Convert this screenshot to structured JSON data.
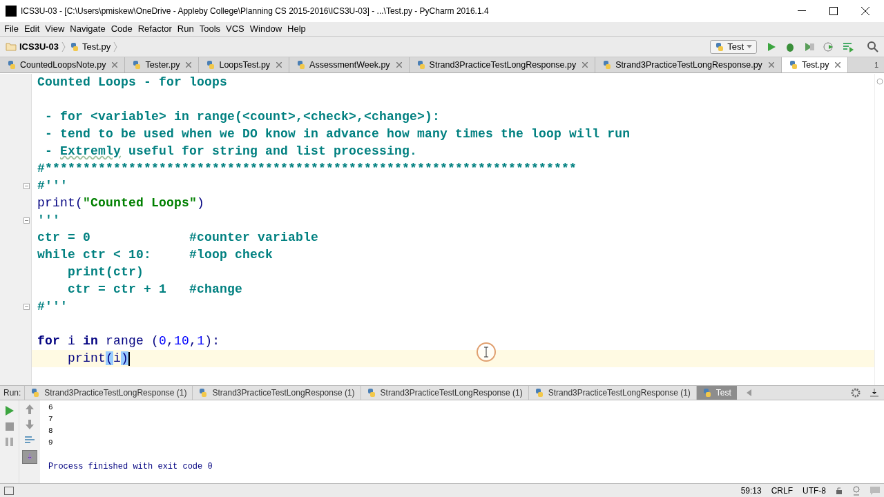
{
  "window": {
    "title": "ICS3U-03 - [C:\\Users\\pmiskew\\OneDrive - Appleby College\\Planning CS 2015-2016\\ICS3U-03] - ...\\Test.py - PyCharm 2016.1.4"
  },
  "menu": [
    "File",
    "Edit",
    "View",
    "Navigate",
    "Code",
    "Refactor",
    "Run",
    "Tools",
    "VCS",
    "Window",
    "Help"
  ],
  "breadcrumbs": [
    {
      "label": "ICS3U-03",
      "kind": "folder"
    },
    {
      "label": "Test.py",
      "kind": "file"
    }
  ],
  "run_config": "Test",
  "tabs": [
    {
      "label": "CountedLoopsNote.py",
      "selected": false
    },
    {
      "label": "Tester.py",
      "selected": false
    },
    {
      "label": "LoopsTest.py",
      "selected": false
    },
    {
      "label": "AssessmentWeek.py",
      "selected": false
    },
    {
      "label": "Strand3PracticeTestLongResponse.py",
      "selected": false
    },
    {
      "label": "Strand3PracticeTestLongResponse.py",
      "selected": false
    },
    {
      "label": "Test.py",
      "selected": true
    }
  ],
  "tabs_overflow": "1",
  "editor": {
    "lines": [
      {
        "tokens": [
          {
            "text": "Counted Loops - for loops",
            "kind": "doc"
          }
        ]
      },
      {
        "blank_line_before": true,
        "tokens": [
          {
            "text": " - for <variable> in range(<count>,<check>,<change>):",
            "kind": "doc"
          }
        ]
      },
      {
        "tokens": [
          {
            "text": " - tend to be used when we DO know in advance how many times the loop will run",
            "kind": "doc"
          }
        ]
      },
      {
        "tokens": [
          {
            "text": " - ",
            "kind": "doc"
          },
          {
            "text": "Extremly",
            "kind": "typo"
          },
          {
            "text": " useful for string and list processing.",
            "kind": "doc"
          }
        ]
      },
      {
        "tokens": [
          {
            "text": "#**********************************************************************",
            "kind": "doc"
          }
        ]
      },
      {
        "fold": true,
        "tokens": [
          {
            "text": "#'''",
            "kind": "doc"
          }
        ]
      },
      {
        "tokens": [
          {
            "text": "print(",
            "kind": "plain"
          },
          {
            "text": "\"Counted Loops\"",
            "kind": "string"
          },
          {
            "text": ")",
            "kind": "plain"
          }
        ]
      },
      {
        "fold": true,
        "tokens": [
          {
            "text": "'''",
            "kind": "doc"
          }
        ]
      },
      {
        "tokens": [
          {
            "text": "ctr = 0             #counter variable",
            "kind": "doc"
          }
        ]
      },
      {
        "tokens": [
          {
            "text": "while ctr < 10:     #loop check",
            "kind": "doc"
          }
        ]
      },
      {
        "tokens": [
          {
            "text": "    print(ctr)",
            "kind": "doc"
          }
        ]
      },
      {
        "tokens": [
          {
            "text": "    ctr = ctr + 1   #change",
            "kind": "doc"
          }
        ]
      },
      {
        "fold": true,
        "tokens": [
          {
            "text": "#'''",
            "kind": "doc"
          }
        ]
      },
      {
        "blank_line_before": true,
        "tokens": [
          {
            "text": "for",
            "kind": "keyword"
          },
          {
            "text": " i ",
            "kind": "plain"
          },
          {
            "text": "in",
            "kind": "keyword"
          },
          {
            "text": " range (",
            "kind": "plain"
          },
          {
            "text": "0",
            "kind": "number"
          },
          {
            "text": ",",
            "kind": "plain"
          },
          {
            "text": "10",
            "kind": "number"
          },
          {
            "text": ",",
            "kind": "plain"
          },
          {
            "text": "1",
            "kind": "number"
          },
          {
            "text": "):",
            "kind": "plain"
          }
        ]
      },
      {
        "current": true,
        "tokens": [
          {
            "text": "    print",
            "kind": "plain"
          },
          {
            "text": "(",
            "kind": "match"
          },
          {
            "text": "i",
            "kind": "plain"
          },
          {
            "text": ")",
            "kind": "match"
          }
        ]
      }
    ]
  },
  "run": {
    "label": "Run:",
    "tabs": [
      {
        "label": "Strand3PracticeTestLongResponse (1)",
        "selected": false
      },
      {
        "label": "Strand3PracticeTestLongResponse (1)",
        "selected": false
      },
      {
        "label": "Strand3PracticeTestLongResponse (1)",
        "selected": false
      },
      {
        "label": "Strand3PracticeTestLongResponse (1)",
        "selected": false
      },
      {
        "label": "Test",
        "selected": true
      }
    ],
    "output": [
      "6",
      "7",
      "8",
      "9"
    ],
    "exit_message": "Process finished with exit code 0"
  },
  "status_bar": {
    "position": "59:13",
    "line_separator": "CRLF",
    "encoding": "UTF-8"
  }
}
